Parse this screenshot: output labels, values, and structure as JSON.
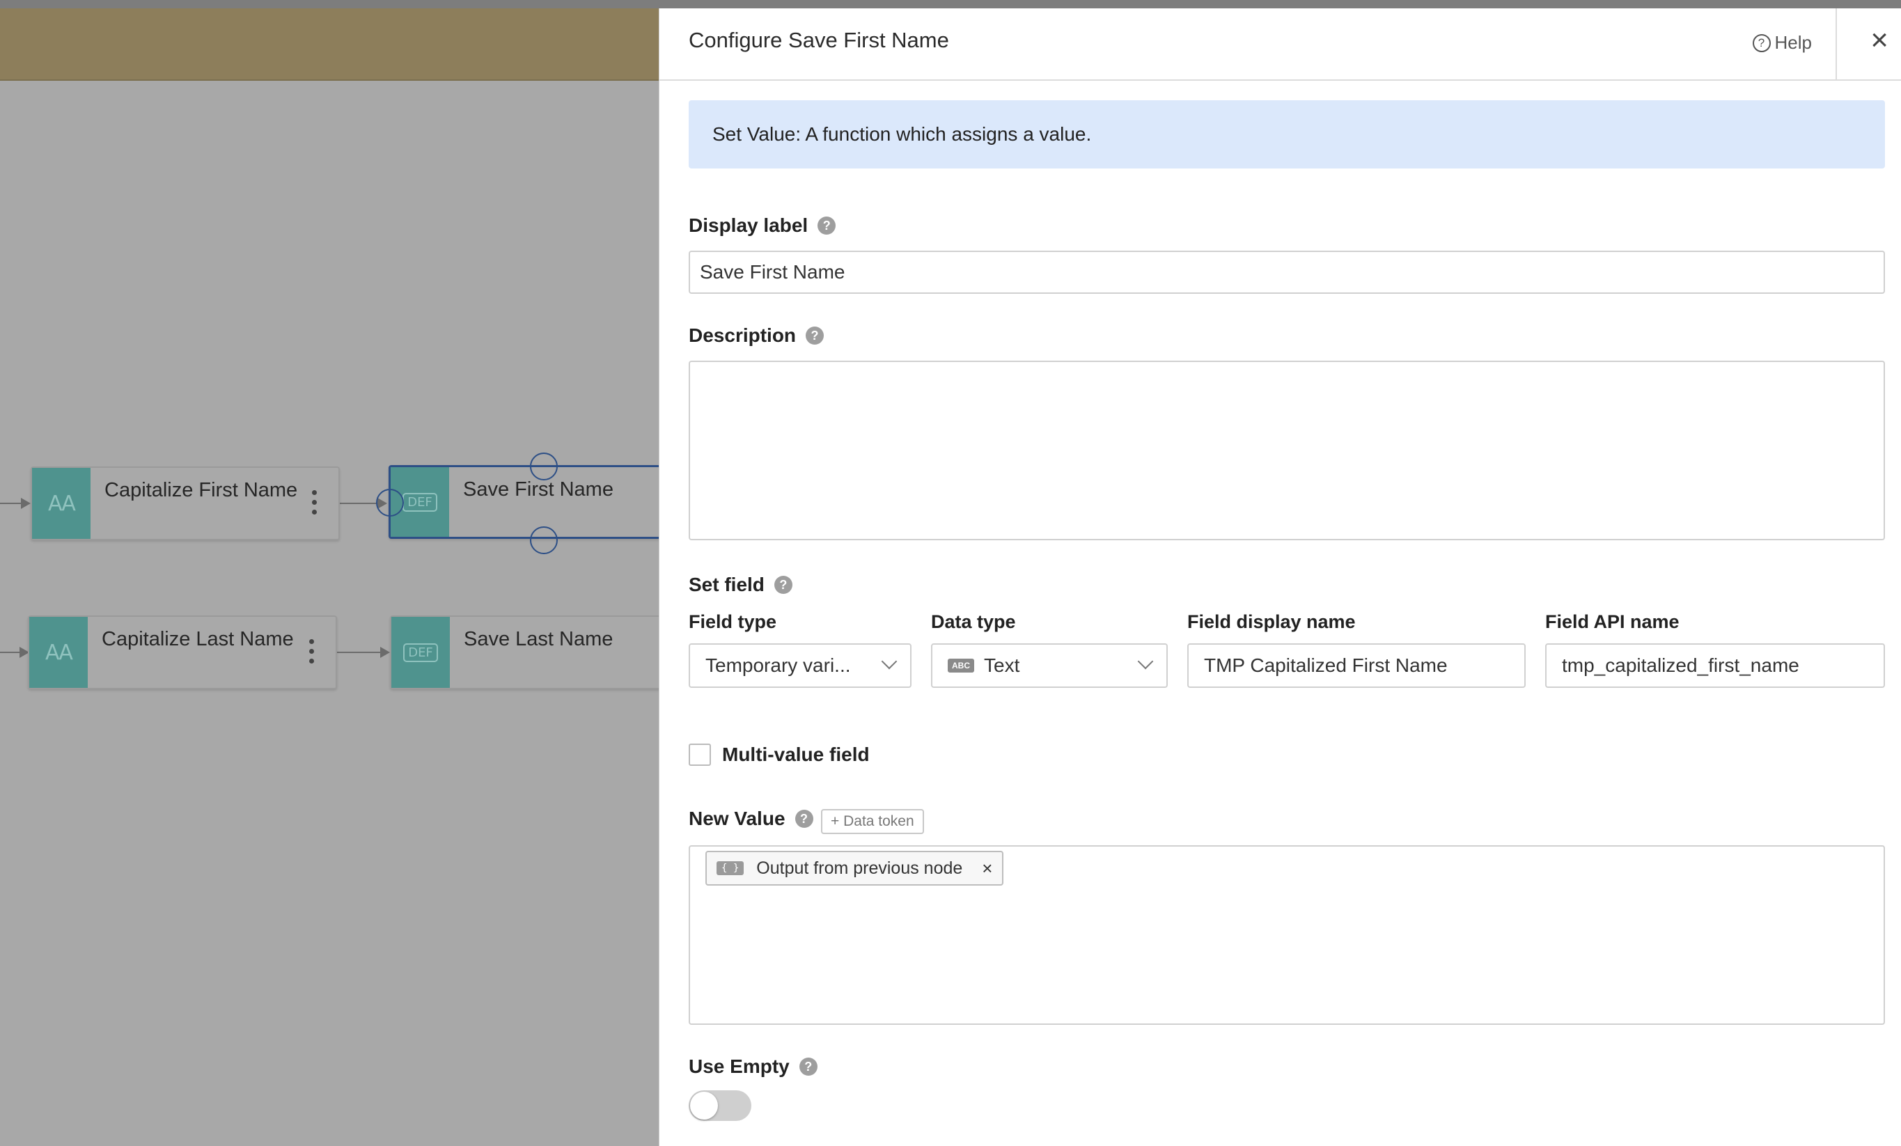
{
  "canvas": {
    "nodes": [
      {
        "label": "Capitalize First Name",
        "icon": "capitalize-icon",
        "icon_glyph": "AA"
      },
      {
        "label": "Save First Name",
        "icon": "def-icon",
        "icon_glyph": "DEF"
      },
      {
        "label": "Capitalize Last Name",
        "icon": "capitalize-icon",
        "icon_glyph": "AA"
      },
      {
        "label": "Save Last Name",
        "icon": "def-icon",
        "icon_glyph": "DEF"
      }
    ]
  },
  "panel": {
    "title": "Configure Save First Name",
    "help_label": "Help",
    "close_glyph": "×",
    "banner": "Set Value: A function which assigns a value.",
    "display_label": {
      "label": "Display label",
      "value": "Save First Name"
    },
    "description": {
      "label": "Description",
      "value": ""
    },
    "set_field": {
      "label": "Set field",
      "field_type": {
        "label": "Field type",
        "value": "Temporary vari..."
      },
      "data_type": {
        "label": "Data type",
        "badge": "ABC",
        "value": "Text"
      },
      "field_display_name": {
        "label": "Field display name",
        "value": "TMP Capitalized First Name"
      },
      "field_api_name": {
        "label": "Field API name",
        "value": "tmp_capitalized_first_name"
      }
    },
    "multi_value": {
      "label": "Multi-value field",
      "checked": false
    },
    "new_value": {
      "label": "New Value",
      "data_token_button": "+ Data token",
      "chip": {
        "icon": "{ }",
        "label": "Output from previous node",
        "remove": "×"
      }
    },
    "use_empty": {
      "label": "Use Empty",
      "enabled": false
    },
    "help_badge": "?"
  },
  "colors": {
    "node_icon": "#4f938e",
    "banner": "#dbe8fb",
    "selected_border": "#2d4f86",
    "header_band": "#8d7e5b"
  }
}
